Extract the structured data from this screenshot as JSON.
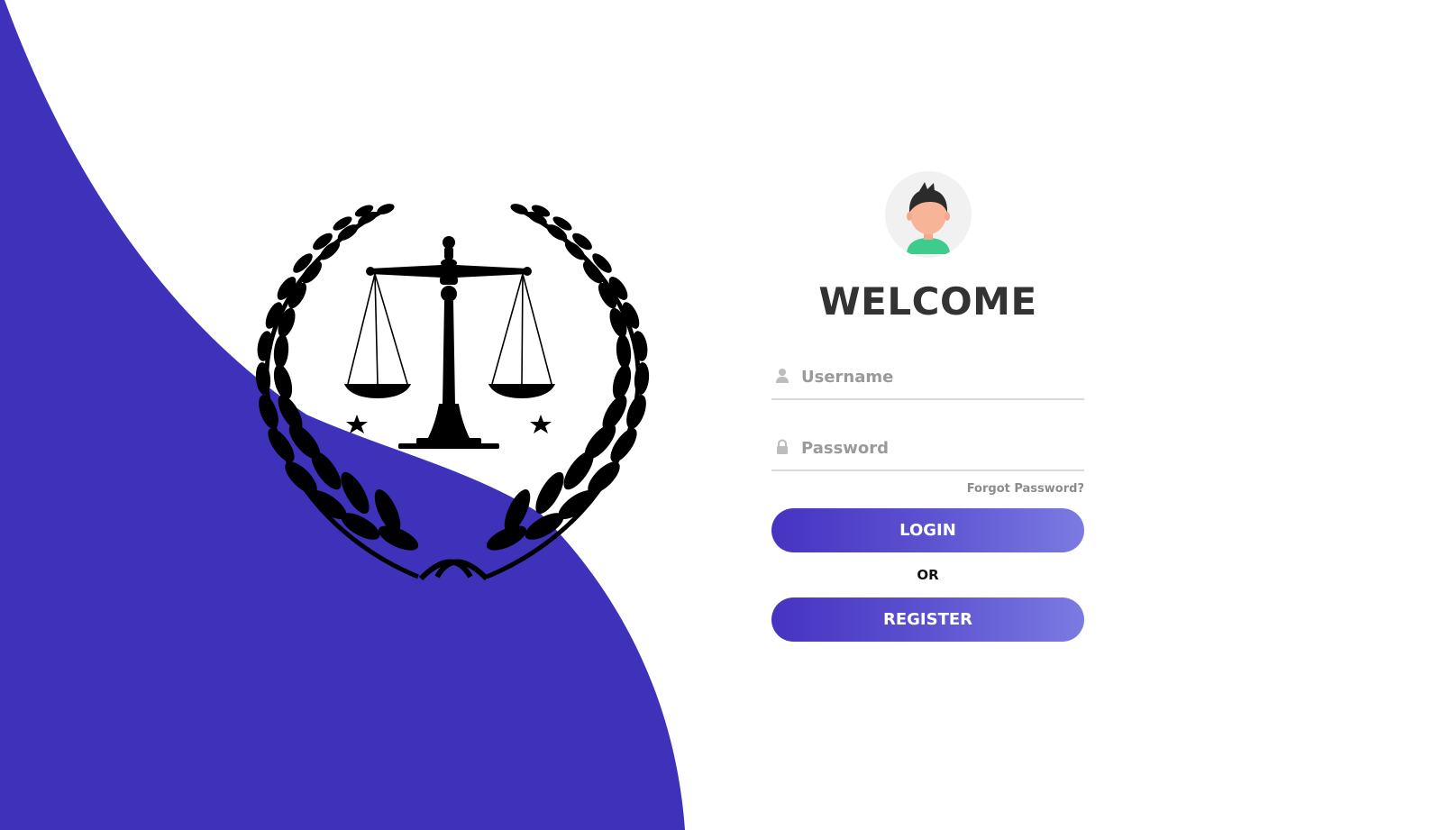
{
  "colors": {
    "accent": "#3e32bb",
    "button_gradient_start": "#4633c2",
    "button_gradient_end": "#7b7be2",
    "heading": "#333333",
    "muted": "#9a9a9a"
  },
  "emblem": {
    "icon": "scales-of-justice-laurel-emblem"
  },
  "login": {
    "avatar_icon": "user-avatar-icon",
    "title": "WELCOME",
    "username_placeholder": "Username",
    "username_icon": "user-icon",
    "password_placeholder": "Password",
    "password_icon": "lock-icon",
    "forgot_password": "Forgot Password?",
    "login_button": "LOGIN",
    "separator": "OR",
    "register_button": "REGISTER"
  }
}
